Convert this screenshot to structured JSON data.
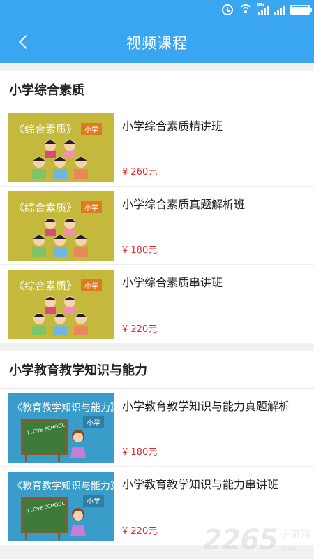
{
  "status_bar": {
    "network_top": "4G",
    "network_bottom": "2G"
  },
  "header": {
    "title": "视频课程"
  },
  "sections": [
    {
      "title": "小学综合素质",
      "courses": [
        {
          "title": "小学综合素质精讲班",
          "price": "¥ 260元",
          "thumb_title": "《综合素质》",
          "thumb_tag": "小学"
        },
        {
          "title": "小学综合素质真题解析班",
          "price": "¥ 180元",
          "thumb_title": "《综合素质》",
          "thumb_tag": "小学"
        },
        {
          "title": "小学综合素质串讲班",
          "price": "¥ 220元",
          "thumb_title": "《综合素质》",
          "thumb_tag": "小学"
        }
      ]
    },
    {
      "title": "小学教育教学知识与能力",
      "courses": [
        {
          "title": "小学教育教学知识与能力真题解析",
          "price": "¥ 180元",
          "thumb_title": "《教育教学知识与能力》",
          "thumb_tag": "小学",
          "board_text": "I LOVE SCHOOL"
        },
        {
          "title": "小学教育教学知识与能力串讲班",
          "price": "¥ 220元",
          "thumb_title": "《教育教学知识与能力》",
          "thumb_tag": "小学",
          "board_text": "I LOVE SCHOOL"
        }
      ]
    }
  ],
  "watermark": {
    "number": "2265",
    "text": "手游网",
    "sub": ".com"
  },
  "colors": {
    "header_bg": "#3aa5f0",
    "price": "#e02a2a",
    "thumb_khaki": "#c4b93c",
    "thumb_teal": "#3a9cc8"
  }
}
